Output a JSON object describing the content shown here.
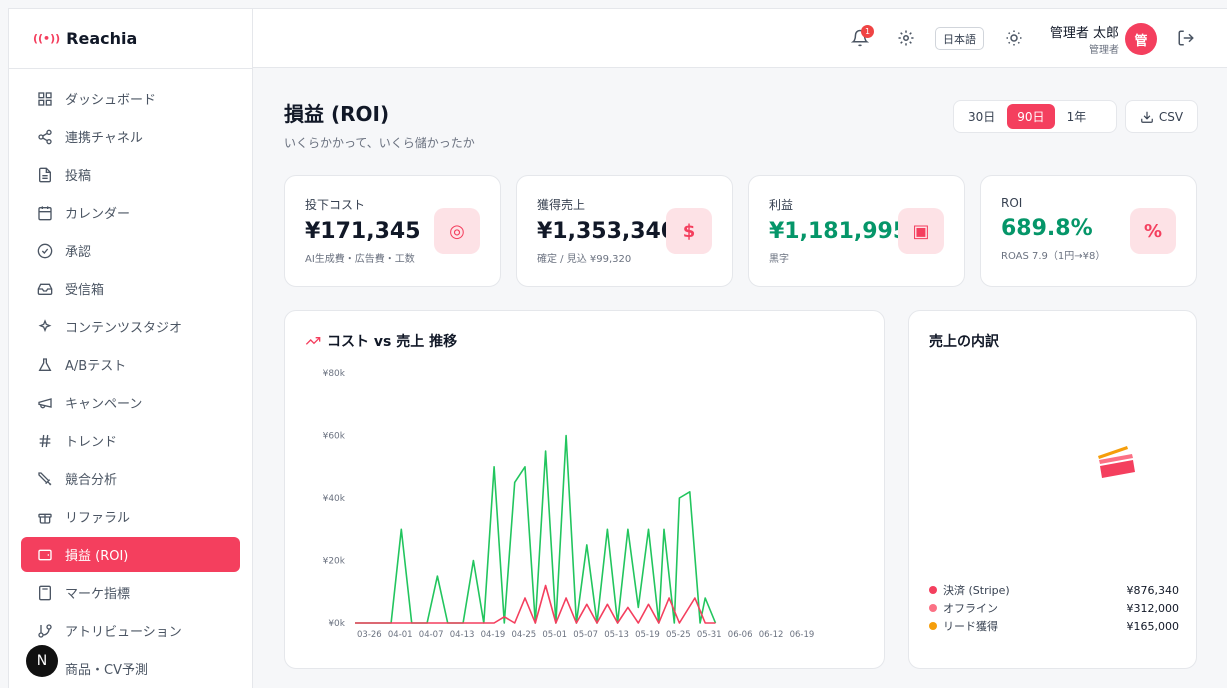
{
  "brand": {
    "name": "Reachia"
  },
  "sidebar": {
    "items": [
      {
        "label": "ダッシュボード",
        "icon": "dashboard-icon"
      },
      {
        "label": "連携チャネル",
        "icon": "share-icon"
      },
      {
        "label": "投稿",
        "icon": "file-icon"
      },
      {
        "label": "カレンダー",
        "icon": "calendar-icon"
      },
      {
        "label": "承認",
        "icon": "check-circle-icon"
      },
      {
        "label": "受信箱",
        "icon": "inbox-icon"
      },
      {
        "label": "コンテンツスタジオ",
        "icon": "sparkles-icon"
      },
      {
        "label": "A/Bテスト",
        "icon": "flask-icon"
      },
      {
        "label": "キャンペーン",
        "icon": "megaphone-icon"
      },
      {
        "label": "トレンド",
        "icon": "hash-icon"
      },
      {
        "label": "競合分析",
        "icon": "swords-icon"
      },
      {
        "label": "リファラル",
        "icon": "gift-icon"
      },
      {
        "label": "損益 (ROI)",
        "icon": "wallet-icon",
        "active": true
      },
      {
        "label": "マーケ指標",
        "icon": "calculator-icon"
      },
      {
        "label": "アトリビューション",
        "icon": "git-branch-icon"
      },
      {
        "label": "商品・CV予測",
        "icon": "box-icon"
      }
    ]
  },
  "topbar": {
    "notification_count": "1",
    "language": "日本語",
    "user_name": "管理者 太郎",
    "user_role": "管理者",
    "avatar_initial": "管"
  },
  "page": {
    "title": "損益 (ROI)",
    "subtitle": "いくらかかって、いくら儲かったか",
    "ranges": [
      "30日",
      "90日",
      "1年"
    ],
    "active_range": "90日",
    "csv_label": "CSV"
  },
  "kpis": [
    {
      "label": "投下コスト",
      "value": "¥171,345",
      "sub": "AI生成費・広告費・工数",
      "icon": "coins-icon",
      "glyph": "◎"
    },
    {
      "label": "獲得売上",
      "value": "¥1,353,340",
      "sub": "確定 / 見込 ¥99,320",
      "icon": "receipt-icon",
      "glyph": "$"
    },
    {
      "label": "利益",
      "value": "¥1,181,995",
      "sub": "黒字",
      "icon": "wallet-icon",
      "glyph": "▣",
      "green": true
    },
    {
      "label": "ROI",
      "value": "689.8%",
      "sub": "ROAS 7.9（1円→¥8）",
      "icon": "percent-icon",
      "glyph": "%",
      "green": true
    }
  ],
  "trend_card": {
    "title": "コスト vs 売上 推移"
  },
  "breakdown_card": {
    "title": "売上の内訳",
    "items": [
      {
        "label": "決済 (Stripe)",
        "value": "¥876,340",
        "color": "#f43f5e"
      },
      {
        "label": "オフライン",
        "value": "¥312,000",
        "color": "#fb7185"
      },
      {
        "label": "リード獲得",
        "value": "¥165,000",
        "color": "#f59e0b"
      }
    ]
  },
  "chart_data": {
    "type": "line",
    "title": "",
    "yticks": [
      "¥0k",
      "¥20k",
      "¥40k",
      "¥60k",
      "¥80k"
    ],
    "ylim": [
      0,
      80000
    ],
    "x_ticks": [
      "03-26",
      "04-01",
      "04-07",
      "04-13",
      "04-19",
      "04-25",
      "05-01",
      "05-07",
      "05-13",
      "05-19",
      "05-25",
      "05-31",
      "06-06",
      "06-12",
      "06-19"
    ],
    "series": [
      {
        "color": "#22c55e",
        "points": [
          [
            0,
            0
          ],
          [
            5,
            0
          ],
          [
            7,
            0
          ],
          [
            9,
            30000
          ],
          [
            11,
            0
          ],
          [
            14,
            0
          ],
          [
            16,
            15000
          ],
          [
            18,
            0
          ],
          [
            21,
            0
          ],
          [
            23,
            20000
          ],
          [
            25,
            0
          ],
          [
            27,
            50000
          ],
          [
            29,
            0
          ],
          [
            31,
            45000
          ],
          [
            33,
            50000
          ],
          [
            35,
            0
          ],
          [
            37,
            55000
          ],
          [
            39,
            0
          ],
          [
            41,
            60000
          ],
          [
            43,
            0
          ],
          [
            45,
            25000
          ],
          [
            47,
            0
          ],
          [
            49,
            30000
          ],
          [
            51,
            0
          ],
          [
            53,
            30000
          ],
          [
            55,
            5000
          ],
          [
            57,
            30000
          ],
          [
            59,
            0
          ],
          [
            60,
            30000
          ],
          [
            62,
            0
          ],
          [
            63,
            40000
          ],
          [
            65,
            42000
          ],
          [
            67,
            0
          ],
          [
            68,
            8000
          ],
          [
            70,
            0
          ]
        ]
      },
      {
        "color": "#f43f5e",
        "points": [
          [
            0,
            0
          ],
          [
            27,
            0
          ],
          [
            29,
            2000
          ],
          [
            31,
            0
          ],
          [
            33,
            8000
          ],
          [
            35,
            0
          ],
          [
            37,
            12000
          ],
          [
            39,
            0
          ],
          [
            41,
            8000
          ],
          [
            43,
            0
          ],
          [
            45,
            6000
          ],
          [
            47,
            0
          ],
          [
            49,
            6000
          ],
          [
            51,
            0
          ],
          [
            53,
            5000
          ],
          [
            55,
            0
          ],
          [
            57,
            6000
          ],
          [
            59,
            0
          ],
          [
            61,
            8000
          ],
          [
            63,
            0
          ],
          [
            66,
            8000
          ],
          [
            68,
            0
          ],
          [
            70,
            0
          ]
        ]
      }
    ]
  },
  "colors": {
    "accent": "#f43f5e",
    "green": "#059669"
  }
}
